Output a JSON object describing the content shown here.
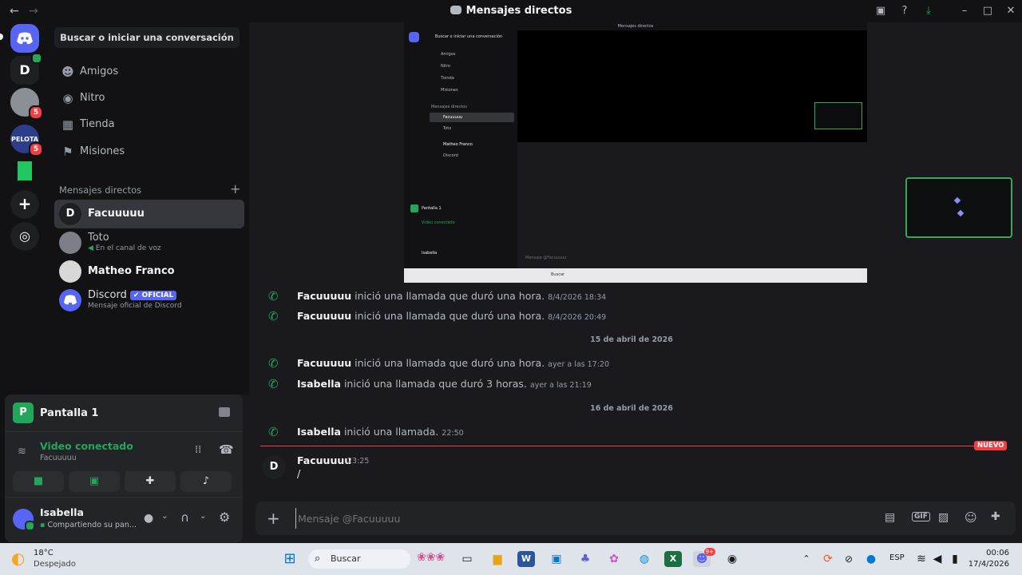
{
  "titlebar": {
    "title": "Mensajes directos",
    "back_icon": "arrow-left-icon",
    "forward_icon": "arrow-right-icon"
  },
  "servers": [
    {
      "name": "discord-home",
      "label": ""
    },
    {
      "name": "server-d",
      "label": "D",
      "badge": ""
    },
    {
      "name": "server-avatar",
      "label": "",
      "badge": "5"
    },
    {
      "name": "server-pelota",
      "label": "",
      "badge": "5"
    },
    {
      "name": "server-green",
      "label": "",
      "badge": ""
    }
  ],
  "sidebar": {
    "search_label": "Buscar o iniciar una conversación",
    "nav": [
      {
        "label": "Amigos",
        "icon": "friends-icon"
      },
      {
        "label": "Nitro",
        "icon": "nitro-icon"
      },
      {
        "label": "Tienda",
        "icon": "shop-icon"
      },
      {
        "label": "Misiones",
        "icon": "quests-icon"
      }
    ],
    "dm_header": "Mensajes directos",
    "dms": [
      {
        "name": "Facuuuuu",
        "avatar": "D",
        "sub": ""
      },
      {
        "name": "Toto",
        "avatar": "",
        "sub": "En el canal de voz"
      },
      {
        "name": "Matheo Franco",
        "avatar": "",
        "sub": ""
      },
      {
        "name": "Discord",
        "avatar": "",
        "badge": "OFICIAL",
        "sub": "Mensaje oficial de Discord"
      }
    ]
  },
  "voice": {
    "screen_name": "Pantalla 1",
    "status": "Video conectado",
    "channel": "Facuuuuu"
  },
  "user": {
    "name": "Isabella",
    "status": "Compartiendo su pan..."
  },
  "stream_preview": {
    "title": "Mensajes directos",
    "search": "Buscar o iniciar una conversación",
    "nav": [
      "Amigos",
      "Nitro",
      "Tienda",
      "Misiones"
    ],
    "dm_header": "Mensajes directos",
    "dms": [
      "Facuuuuu",
      "Toto",
      "Matheo Franco",
      "Discord"
    ],
    "voice_screen": "Pantalla 1",
    "voice_status": "Video conectado",
    "user": "Isabella",
    "placeholder": "Mensaje @Facuuuuu",
    "taskbar_search": "Buscar"
  },
  "messages": [
    {
      "kind": "call",
      "author": "Facuuuuu",
      "text": "inició una llamada que duró una hora.",
      "time": "8/4/2026 18:34"
    },
    {
      "kind": "call",
      "author": "Facuuuuu",
      "text": "inició una llamada que duró una hora.",
      "time": "8/4/2026 20:49"
    },
    {
      "kind": "divider",
      "text": "15 de abril de 2026"
    },
    {
      "kind": "call",
      "author": "Facuuuuu",
      "text": "inició una llamada que duró una hora.",
      "time": "ayer a las 17:20"
    },
    {
      "kind": "call",
      "author": "Isabella",
      "text": "inició una llamada que duró 3 horas.",
      "time": "ayer a las 21:19"
    },
    {
      "kind": "divider",
      "text": "16 de abril de 2026"
    },
    {
      "kind": "call",
      "author": "Isabella",
      "text": "inició una llamada.",
      "time": "22:50"
    }
  ],
  "new_badge": "NUEVO",
  "last_message": {
    "author": "Facuuuuu",
    "time": "23:25",
    "text": "/",
    "avatar": "D"
  },
  "composer": {
    "placeholder": "Mensaje @Facuuuuu"
  },
  "taskbar": {
    "weather_temp": "18°C",
    "weather_desc": "Despejado",
    "search": "Buscar",
    "lang": "ESP",
    "time": "00:06",
    "date": "17/4/2026",
    "discord_badge": "9+"
  },
  "colors": {
    "accent": "#5865f2",
    "green": "#23a55a",
    "red": "#f23f43"
  }
}
